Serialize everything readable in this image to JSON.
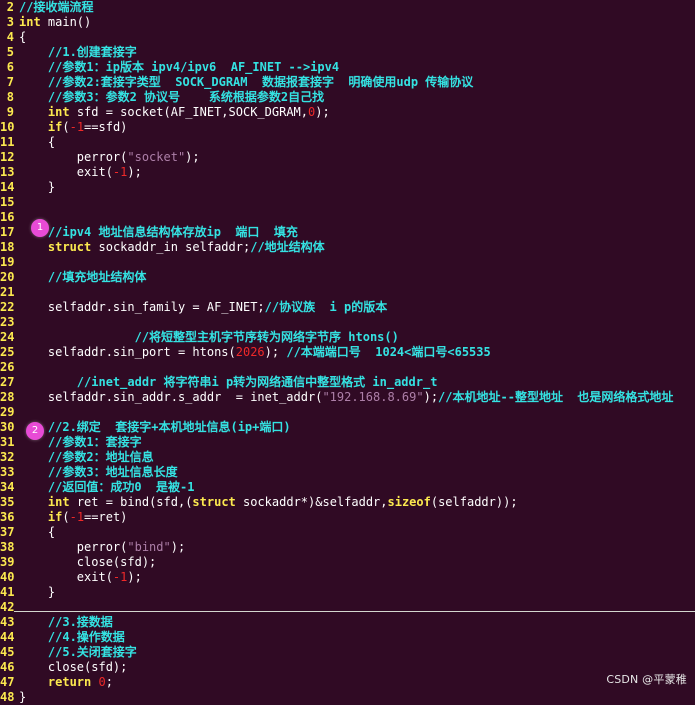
{
  "editor": {
    "lines": [
      {
        "n": "2",
        "segments": [
          {
            "t": "//接收端流程",
            "c": "comment"
          }
        ]
      },
      {
        "n": "3",
        "segments": [
          {
            "t": "int",
            "c": "kw"
          },
          {
            "t": " main()",
            "c": ""
          }
        ]
      },
      {
        "n": "4",
        "segments": [
          {
            "t": "{",
            "c": ""
          }
        ]
      },
      {
        "n": "5",
        "segments": [
          {
            "t": "    //1.创建套接字",
            "c": "comment"
          }
        ]
      },
      {
        "n": "6",
        "segments": [
          {
            "t": "    //参数1：ip版本 ipv4/ipv6  AF_INET -->ipv4",
            "c": "comment"
          }
        ]
      },
      {
        "n": "7",
        "segments": [
          {
            "t": "    //参数2:套接字类型  SOCK_DGRAM  数据报套接字  明确使用udp 传输协议",
            "c": "comment"
          }
        ]
      },
      {
        "n": "8",
        "segments": [
          {
            "t": "    //参数3：参数2 协议号    系统根据参数2自己找",
            "c": "comment"
          }
        ]
      },
      {
        "n": "9",
        "segments": [
          {
            "t": "    ",
            "c": ""
          },
          {
            "t": "int",
            "c": "kw"
          },
          {
            "t": " sfd = socket(AF_INET,SOCK_DGRAM,",
            "c": ""
          },
          {
            "t": "0",
            "c": "num"
          },
          {
            "t": ");",
            "c": ""
          }
        ]
      },
      {
        "n": "10",
        "segments": [
          {
            "t": "    ",
            "c": ""
          },
          {
            "t": "if",
            "c": "kw"
          },
          {
            "t": "(",
            "c": ""
          },
          {
            "t": "-1",
            "c": "num"
          },
          {
            "t": "==sfd)",
            "c": ""
          }
        ]
      },
      {
        "n": "11",
        "segments": [
          {
            "t": "    {",
            "c": ""
          }
        ]
      },
      {
        "n": "12",
        "segments": [
          {
            "t": "        perror(",
            "c": ""
          },
          {
            "t": "\"socket\"",
            "c": "str"
          },
          {
            "t": ");",
            "c": ""
          }
        ]
      },
      {
        "n": "13",
        "segments": [
          {
            "t": "        exit(",
            "c": ""
          },
          {
            "t": "-1",
            "c": "num"
          },
          {
            "t": ");",
            "c": ""
          }
        ]
      },
      {
        "n": "14",
        "segments": [
          {
            "t": "    }",
            "c": ""
          }
        ]
      },
      {
        "n": "15",
        "segments": []
      },
      {
        "n": "16",
        "segments": []
      },
      {
        "n": "17",
        "segments": [
          {
            "t": "    //ipv4 地址信息结构体存放ip  端口  填充",
            "c": "comment"
          }
        ]
      },
      {
        "n": "18",
        "segments": [
          {
            "t": "    ",
            "c": ""
          },
          {
            "t": "struct",
            "c": "kw"
          },
          {
            "t": " sockaddr_in selfaddr;",
            "c": ""
          },
          {
            "t": "//地址结构体",
            "c": "comment"
          }
        ]
      },
      {
        "n": "19",
        "segments": []
      },
      {
        "n": "20",
        "segments": [
          {
            "t": "    //填充地址结构体",
            "c": "comment"
          }
        ]
      },
      {
        "n": "21",
        "segments": []
      },
      {
        "n": "22",
        "segments": [
          {
            "t": "    selfaddr.sin_family = AF_INET;",
            "c": ""
          },
          {
            "t": "//协议族  i p的版本",
            "c": "comment"
          }
        ]
      },
      {
        "n": "23",
        "segments": []
      },
      {
        "n": "24",
        "segments": [
          {
            "t": "                //将短整型主机字节序转为网络字节序 htons()",
            "c": "comment"
          }
        ]
      },
      {
        "n": "25",
        "segments": [
          {
            "t": "    selfaddr.sin_port = htons(",
            "c": ""
          },
          {
            "t": "2026",
            "c": "num"
          },
          {
            "t": "); ",
            "c": ""
          },
          {
            "t": "//本端端口号  1024<端口号<65535",
            "c": "comment"
          }
        ]
      },
      {
        "n": "26",
        "segments": []
      },
      {
        "n": "27",
        "segments": [
          {
            "t": "        //inet_addr 将字符串i p转为网络通信中整型格式 in_addr_t",
            "c": "comment"
          }
        ]
      },
      {
        "n": "28",
        "segments": [
          {
            "t": "    selfaddr.sin_addr.s_addr  = inet_addr(",
            "c": ""
          },
          {
            "t": "\"192.168.8.69\"",
            "c": "str"
          },
          {
            "t": ");",
            "c": ""
          },
          {
            "t": "//本机地址--整型地址  也是网络格式地址",
            "c": "comment"
          }
        ]
      },
      {
        "n": "29",
        "segments": []
      },
      {
        "n": "30",
        "segments": [
          {
            "t": "    //2.绑定  套接字+本机地址信息(ip+端口)",
            "c": "comment"
          }
        ]
      },
      {
        "n": "31",
        "segments": [
          {
            "t": "    //参数1：套接字",
            "c": "comment"
          }
        ]
      },
      {
        "n": "32",
        "segments": [
          {
            "t": "    //参数2：地址信息",
            "c": "comment"
          }
        ]
      },
      {
        "n": "33",
        "segments": [
          {
            "t": "    //参数3：地址信息长度",
            "c": "comment"
          }
        ]
      },
      {
        "n": "34",
        "segments": [
          {
            "t": "    //返回值：成功0  是被-1",
            "c": "comment"
          }
        ]
      },
      {
        "n": "35",
        "segments": [
          {
            "t": "    ",
            "c": ""
          },
          {
            "t": "int",
            "c": "kw"
          },
          {
            "t": " ret = bind(sfd,(",
            "c": ""
          },
          {
            "t": "struct",
            "c": "kw"
          },
          {
            "t": " sockaddr*)&selfaddr,",
            "c": ""
          },
          {
            "t": "sizeof",
            "c": "kw"
          },
          {
            "t": "(selfaddr));",
            "c": ""
          }
        ]
      },
      {
        "n": "36",
        "segments": [
          {
            "t": "    ",
            "c": ""
          },
          {
            "t": "if",
            "c": "kw"
          },
          {
            "t": "(",
            "c": ""
          },
          {
            "t": "-1",
            "c": "num"
          },
          {
            "t": "==ret)",
            "c": ""
          }
        ]
      },
      {
        "n": "37",
        "segments": [
          {
            "t": "    {",
            "c": ""
          }
        ]
      },
      {
        "n": "38",
        "segments": [
          {
            "t": "        perror(",
            "c": ""
          },
          {
            "t": "\"bind\"",
            "c": "str"
          },
          {
            "t": ");",
            "c": ""
          }
        ]
      },
      {
        "n": "39",
        "segments": [
          {
            "t": "        close(sfd);",
            "c": ""
          }
        ]
      },
      {
        "n": "40",
        "segments": [
          {
            "t": "        exit(",
            "c": ""
          },
          {
            "t": "-1",
            "c": "num"
          },
          {
            "t": ");",
            "c": ""
          }
        ]
      },
      {
        "n": "41",
        "segments": [
          {
            "t": "    }",
            "c": ""
          }
        ]
      },
      {
        "n": "42",
        "segments": []
      },
      {
        "n": "43",
        "segments": [
          {
            "t": "    //3.接数据",
            "c": "comment"
          }
        ]
      },
      {
        "n": "44",
        "segments": [
          {
            "t": "    //4.操作数据",
            "c": "comment"
          }
        ]
      },
      {
        "n": "45",
        "segments": [
          {
            "t": "    //5.关闭套接字",
            "c": "comment"
          }
        ]
      },
      {
        "n": "46",
        "segments": [
          {
            "t": "    close(sfd);",
            "c": ""
          }
        ]
      },
      {
        "n": "47",
        "segments": [
          {
            "t": "    ",
            "c": ""
          },
          {
            "t": "return",
            "c": "kw"
          },
          {
            "t": " ",
            "c": ""
          },
          {
            "t": "0",
            "c": "num"
          },
          {
            "t": ";",
            "c": ""
          }
        ]
      },
      {
        "n": "48",
        "segments": [
          {
            "t": "}",
            "c": ""
          }
        ]
      }
    ]
  },
  "markers": [
    {
      "label": "1",
      "line": "17"
    },
    {
      "label": "2",
      "line": "30"
    }
  ],
  "watermark": "CSDN @平蒙稚",
  "colors": {
    "background": "#300a24",
    "line_number": "#fce94f",
    "comment": "#34e2e2",
    "keyword": "#fce94f",
    "string": "#ad7fa8",
    "number": "#ef2929",
    "marker": "#e84bd6"
  }
}
